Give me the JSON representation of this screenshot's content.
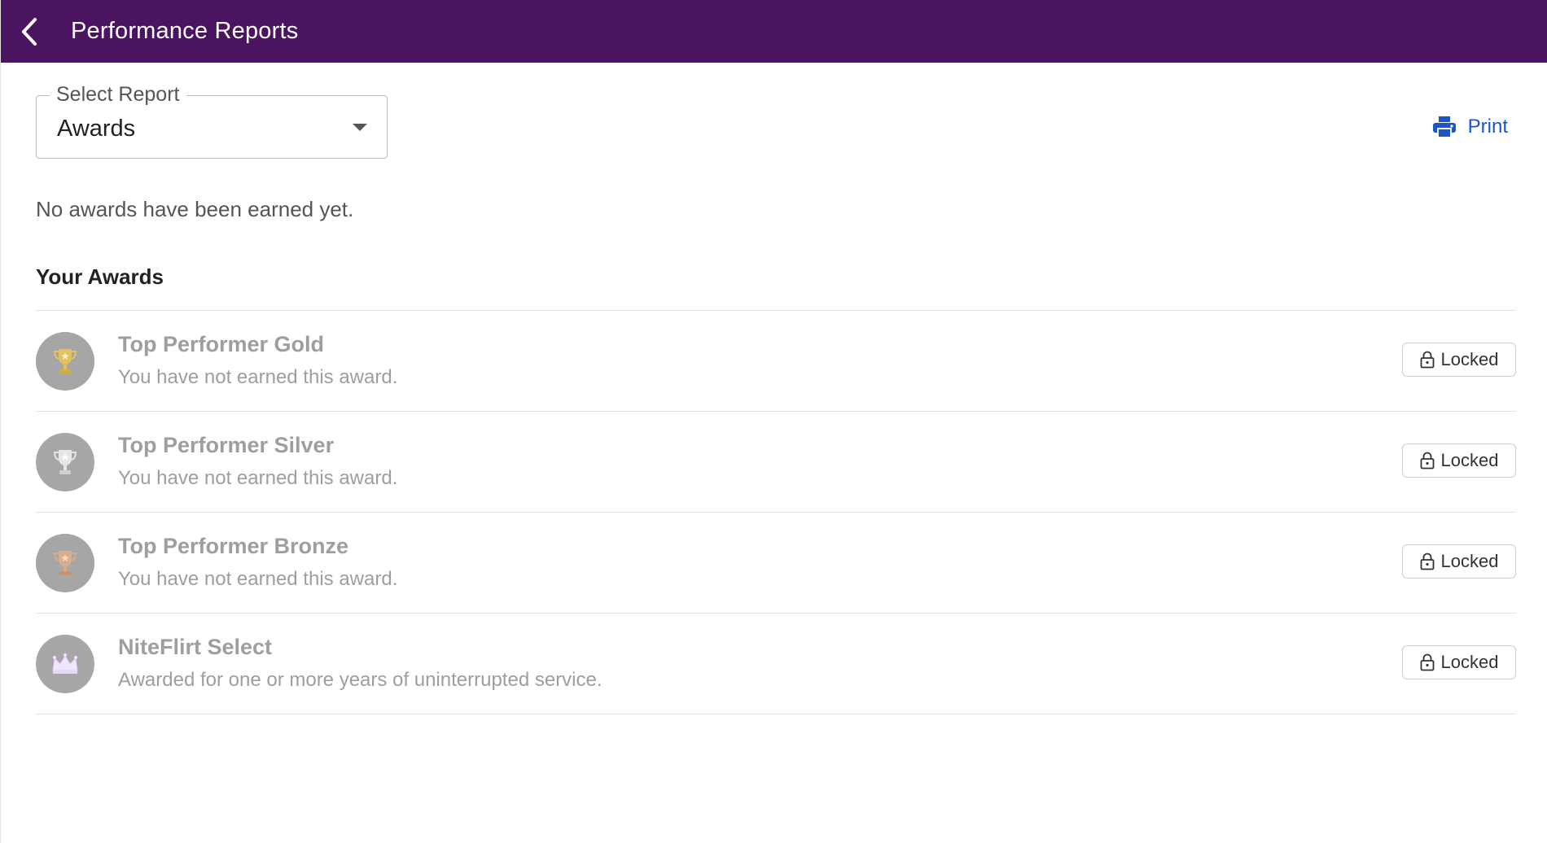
{
  "header": {
    "title": "Performance Reports",
    "back_icon": "chevron-left-icon",
    "background": "#4a1460"
  },
  "report_select": {
    "label": "Select Report",
    "value": "Awards"
  },
  "print": {
    "label": "Print",
    "icon": "printer-icon",
    "color": "#1a56c7"
  },
  "empty_message": "No awards have been earned yet.",
  "awards_section": {
    "title": "Your Awards",
    "items": [
      {
        "name": "Top Performer Gold",
        "description": "You have not earned this award.",
        "icon": "trophy-gold-icon",
        "status": "Locked"
      },
      {
        "name": "Top Performer Silver",
        "description": "You have not earned this award.",
        "icon": "trophy-silver-icon",
        "status": "Locked"
      },
      {
        "name": "Top Performer Bronze",
        "description": "You have not earned this award.",
        "icon": "trophy-bronze-icon",
        "status": "Locked"
      },
      {
        "name": "NiteFlirt Select",
        "description": "Awarded for one or more years of uninterrupted service.",
        "icon": "crown-icon",
        "status": "Locked"
      }
    ]
  }
}
